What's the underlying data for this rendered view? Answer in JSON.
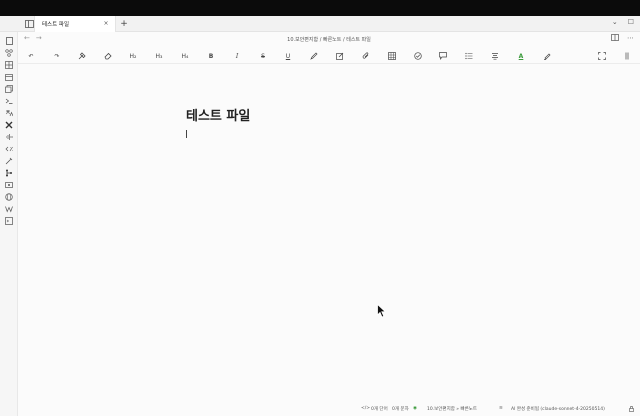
{
  "tab": {
    "title": "테스트 파일",
    "close": "×"
  },
  "newtab": {
    "label": "+"
  },
  "tabbar_right": {
    "chevron": "⌄",
    "square": "☐"
  },
  "nav": {
    "back": "←",
    "forward": "→",
    "breadcrumb": "10.보안편지함 / 빠른노트 / 테스트 파일",
    "more": "⋯"
  },
  "toolbar": {
    "undo": "↶",
    "redo": "↷",
    "h2": "H₂",
    "h3": "H₃",
    "h4": "H₄",
    "bold": "B",
    "italic": "I",
    "strike": "S",
    "underline": "U",
    "font_color": "A",
    "font_color_value": "#3a9a3a"
  },
  "editor": {
    "title": "테스트 파일"
  },
  "status": {
    "words": "0개 단어",
    "chars": "0개 문자",
    "path": "10.보안편지함 » 빠른노트",
    "ai": "AI 완성 준비됨 (claude-sonnet-4-20250514)"
  },
  "colors": {
    "accent": "#3a9a3a",
    "chrome": "#f2f2f2",
    "page": "#fbfbfb"
  }
}
